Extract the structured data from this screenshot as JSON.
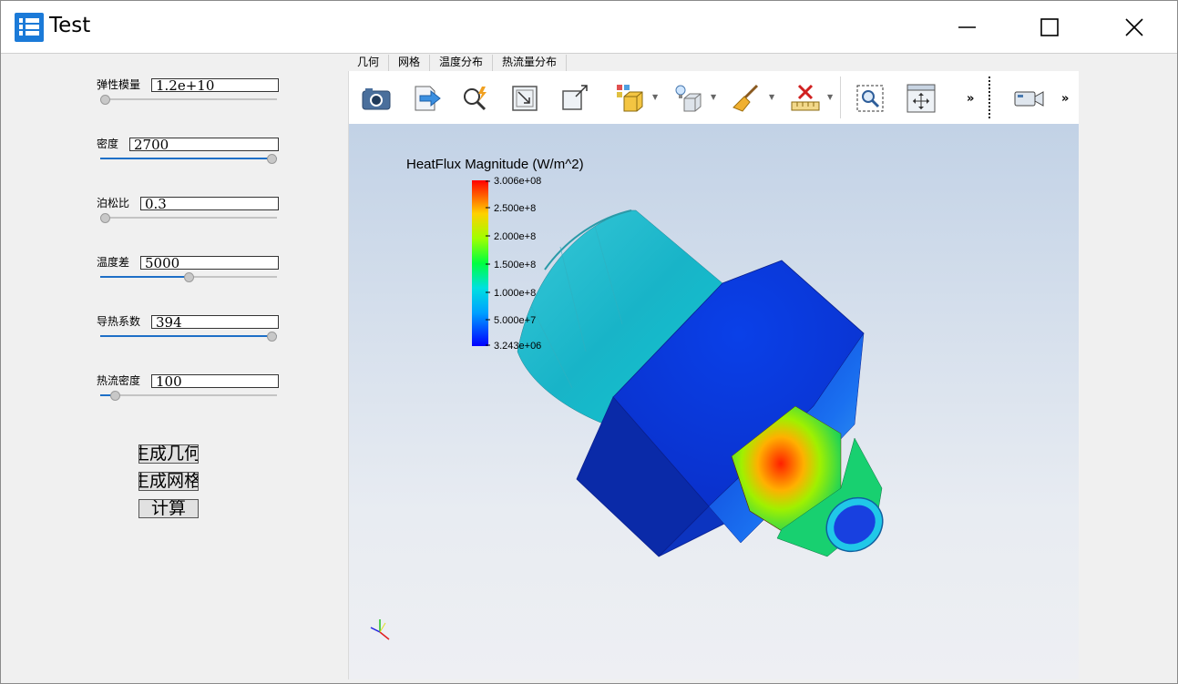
{
  "window": {
    "title": "Test"
  },
  "params": [
    {
      "label": "弹性模量",
      "value": "1.2e+10",
      "fraction": 0.0
    },
    {
      "label": "密度",
      "value": "2700",
      "fraction": 1.0
    },
    {
      "label": "泊松比",
      "value": "0.3",
      "fraction": 0.0
    },
    {
      "label": "温度差",
      "value": "5000",
      "fraction": 0.5
    },
    {
      "label": "导热系数",
      "value": "394",
      "fraction": 1.0
    },
    {
      "label": "热流密度",
      "value": "100",
      "fraction": 0.08
    }
  ],
  "buttons": {
    "gen_geometry": "生成几何",
    "gen_mesh": "生成网格",
    "compute": "计算"
  },
  "tabs": [
    "几何",
    "网格",
    "温度分布",
    "热流量分布"
  ],
  "active_tab": 3,
  "toolbar": {
    "icons": [
      "camera-icon",
      "export-icon",
      "interactive-select-icon",
      "zoom-box-icon",
      "zoom-to-selection-icon",
      "representation-icon",
      "lighting-icon",
      "clear-icon",
      "measure-icon",
      "zoom-to-fit-icon",
      "reset-view-icon",
      "more-icon",
      "camera-view-icon",
      "more-icon"
    ]
  },
  "legend": {
    "title": "HeatFlux Magnitude (W/m^2)",
    "ticks": [
      "3.006e+08",
      "2.500e+8",
      "2.000e+8",
      "1.500e+8",
      "1.000e+8",
      "5.000e+7",
      "3.243e+06"
    ],
    "max": 300600000,
    "min": 3243000
  },
  "colors": {
    "accent": "#1e6fc7",
    "app_icon": "#1b7ad8"
  }
}
